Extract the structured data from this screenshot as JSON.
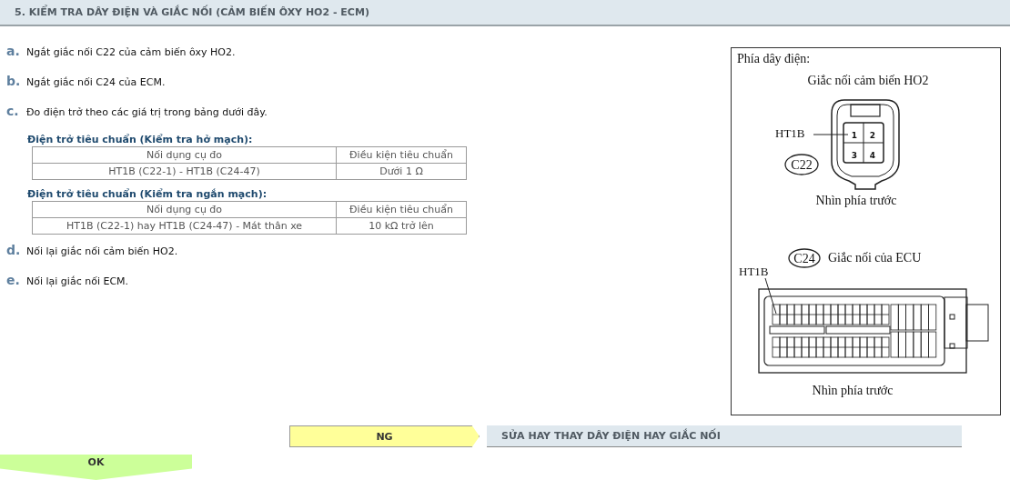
{
  "section": {
    "title": "5. KIỂM TRA DÂY ĐIỆN VÀ GIẮC NỐI (CẢM BIẾN ÔXY HO2 - ECM)"
  },
  "steps": [
    {
      "letter": "a.",
      "text": "Ngắt giắc nối C22 của cảm biến ôxy HO2."
    },
    {
      "letter": "b.",
      "text": "Ngắt giắc nối C24 của ECM."
    },
    {
      "letter": "c.",
      "text": "Đo điện trở theo các giá trị trong bảng dưới đây.",
      "tables": [
        {
          "caption": "Điện trở tiêu chuẩn (Kiểm tra hở mạch):",
          "columns": [
            "Nối dụng cụ đo",
            "Điều kiện tiêu chuẩn"
          ],
          "rows": [
            [
              "HT1B (C22-1) - HT1B (C24-47)",
              "Dưới 1 Ω"
            ]
          ]
        },
        {
          "caption": "Điện trở tiêu chuẩn (Kiểm tra ngắn mạch):",
          "columns": [
            "Nối dụng cụ đo",
            "Điều kiện tiêu chuẩn"
          ],
          "rows": [
            [
              "HT1B (C22-1) hay HT1B (C24-47) - Mát thân xe",
              "10 kΩ trở lên"
            ]
          ]
        }
      ]
    },
    {
      "letter": "d.",
      "text": "Nối lại giắc nối cảm biến HO2."
    },
    {
      "letter": "e.",
      "text": "Nối lại giắc nối ECM."
    }
  ],
  "diagram": {
    "heading": "Phía dây điện:",
    "sensor_connector": {
      "title": "Giắc nối cảm biến HO2",
      "pin_label": "HT1B",
      "pins": [
        "1",
        "2",
        "3",
        "4"
      ],
      "code": "C22",
      "caption": "Nhìn phía trước"
    },
    "ecu_connector": {
      "code": "C24",
      "title": "Giắc nối của ECU",
      "pin_label": "HT1B",
      "caption": "Nhìn phía trước"
    }
  },
  "results": {
    "ng": {
      "label": "NG",
      "action": "SỬA HAY THAY DÂY ĐIỆN HAY GIẮC NỐI"
    },
    "ok": {
      "label": "OK"
    }
  }
}
